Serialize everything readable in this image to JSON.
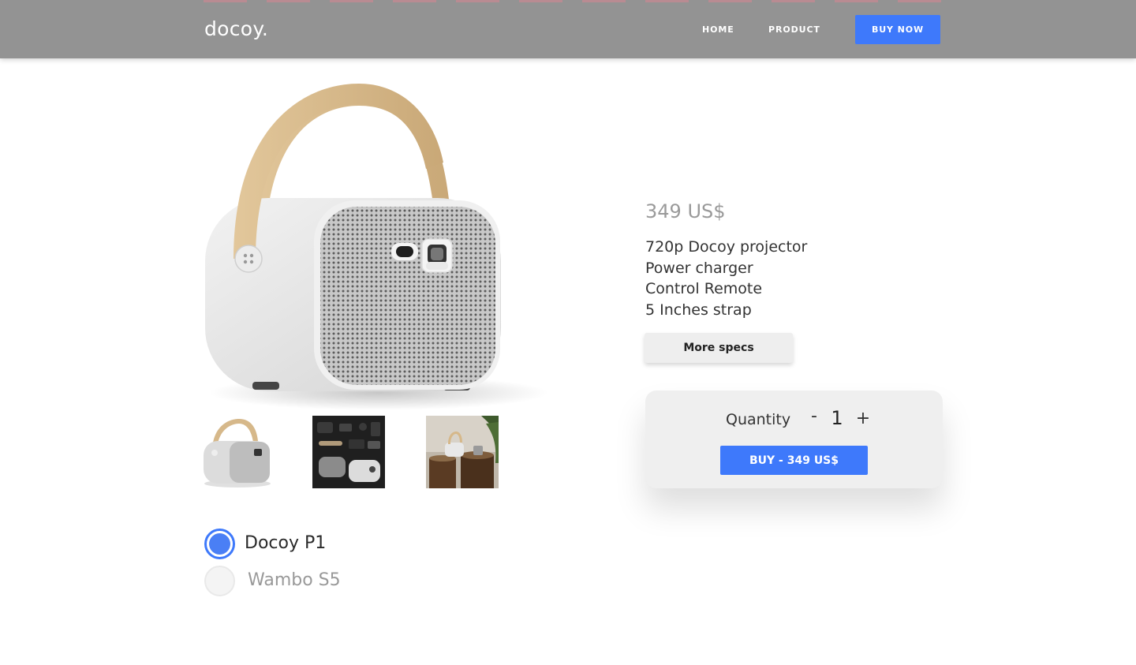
{
  "nav": {
    "brand": "docoy.",
    "links": [
      "HOME",
      "PRODUCT"
    ],
    "buy_label": "BUY NOW"
  },
  "product": {
    "price": "349 US$",
    "features": [
      "720p Docoy projector",
      "Power charger",
      "Control Remote",
      "5 Inches strap"
    ],
    "more_specs_label": "More specs",
    "quantity_label": "Quantity",
    "quantity_minus": "-",
    "quantity_value": "1",
    "quantity_plus": "+",
    "buy_button_label": "BUY - 349 US$"
  },
  "models": [
    {
      "name": "Docoy P1",
      "selected": true
    },
    {
      "name": "Wambo S5",
      "selected": false
    }
  ],
  "colors": {
    "accent": "#3e79fb",
    "navbar": "#939393",
    "strap": "#d6b88a",
    "body": "#e6e6e6"
  },
  "icons": {
    "projector_image": "projector-icon",
    "thumbnails": [
      "projector-thumbnail",
      "accessories-thumbnail",
      "lifestyle-thumbnail"
    ]
  }
}
